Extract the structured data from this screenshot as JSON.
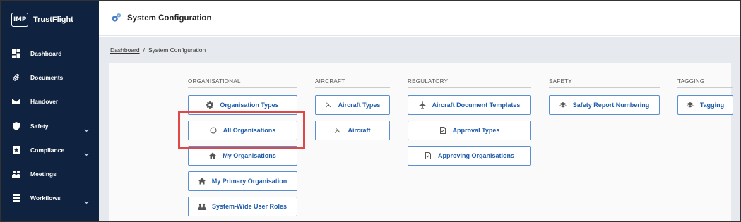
{
  "brand": {
    "logo": "IMP",
    "name": "TrustFlight"
  },
  "sidebar": {
    "items": [
      {
        "label": "Dashboard",
        "icon": "dashboard-icon",
        "has_chevron": false
      },
      {
        "label": "Documents",
        "icon": "paperclip-icon",
        "has_chevron": false
      },
      {
        "label": "Handover",
        "icon": "envelope-icon",
        "has_chevron": false
      },
      {
        "label": "Safety",
        "icon": "shield-icon",
        "has_chevron": true
      },
      {
        "label": "Compliance",
        "icon": "badge-icon",
        "has_chevron": true
      },
      {
        "label": "Meetings",
        "icon": "users-icon",
        "has_chevron": false
      },
      {
        "label": "Workflows",
        "icon": "workflow-icon",
        "has_chevron": true
      }
    ]
  },
  "header": {
    "title": "System Configuration",
    "icon": "settings-icon"
  },
  "breadcrumb": {
    "link": "Dashboard",
    "separator": "/",
    "current": "System Configuration"
  },
  "sections": {
    "organisational": {
      "title": "ORGANISATIONAL",
      "buttons": [
        {
          "label": "Organisation Types",
          "icon": "gear-icon"
        },
        {
          "label": "All Organisations",
          "icon": "circle-icon"
        },
        {
          "label": "My Organisations",
          "icon": "home-icon"
        },
        {
          "label": "My Primary Organisation",
          "icon": "home-icon"
        },
        {
          "label": "System-Wide User Roles",
          "icon": "users-icon"
        }
      ]
    },
    "aircraft": {
      "title": "AIRCRAFT",
      "buttons": [
        {
          "label": "Aircraft Types",
          "icon": "propeller-icon"
        },
        {
          "label": "Aircraft",
          "icon": "propeller-icon"
        }
      ]
    },
    "regulatory": {
      "title": "REGULATORY",
      "buttons": [
        {
          "label": "Aircraft Document Templates",
          "icon": "plane-icon"
        },
        {
          "label": "Approval Types",
          "icon": "document-check-icon"
        },
        {
          "label": "Approving Organisations",
          "icon": "document-check-icon"
        }
      ]
    },
    "safety": {
      "title": "SAFETY",
      "buttons": [
        {
          "label": "Safety Report Numbering",
          "icon": "layers-icon"
        }
      ]
    },
    "tagging": {
      "title": "TAGGING",
      "buttons": [
        {
          "label": "Tagging",
          "icon": "layers-icon"
        }
      ]
    }
  },
  "highlight_color": "#e04848",
  "accent_color": "#1f5cab",
  "sidebar_color": "#0f2340"
}
